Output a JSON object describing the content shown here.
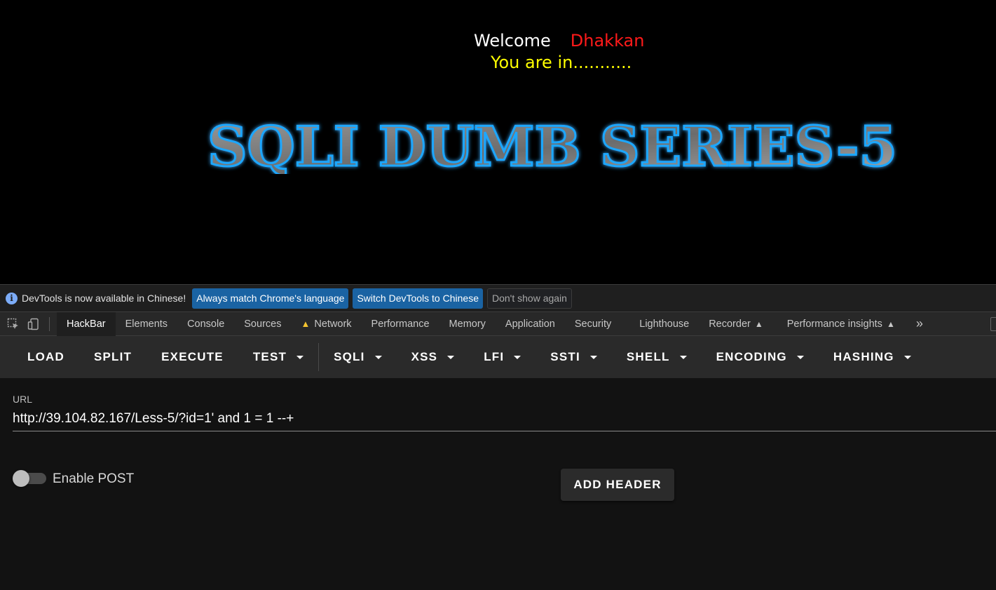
{
  "page": {
    "welcome_word": "Welcome",
    "username": "Dhakkan",
    "status": "You are in...........",
    "banner_text": "SQLI DUMB SERIES-5",
    "colors": {
      "welcome": "#ffffff",
      "username": "#ff1a1a",
      "status": "#ffff00",
      "banner_glow": "#1ea7ff"
    }
  },
  "infobar": {
    "message": "DevTools is now available in Chinese!",
    "btn_match": "Always match Chrome's language",
    "btn_switch": "Switch DevTools to Chinese",
    "btn_dismiss": "Don't show again"
  },
  "tabs": {
    "hackbar": "HackBar",
    "elements": "Elements",
    "console": "Console",
    "sources": "Sources",
    "network": "Network",
    "performance": "Performance",
    "memory": "Memory",
    "application": "Application",
    "security": "Security",
    "lighthouse": "Lighthouse",
    "recorder": "Recorder",
    "performance_insights": "Performance insights",
    "more": "»"
  },
  "hackbar": {
    "load": "LOAD",
    "split": "SPLIT",
    "execute": "EXECUTE",
    "test": "TEST",
    "sqli": "SQLI",
    "xss": "XSS",
    "lfi": "LFI",
    "ssti": "SSTI",
    "shell": "SHELL",
    "encoding": "ENCODING",
    "hashing": "HASHING",
    "url_label": "URL",
    "url_value": "http://39.104.82.167/Less-5/?id=1' and 1 = 1 --+",
    "enable_post_label": "Enable POST",
    "enable_post": false,
    "add_header": "ADD HEADER"
  }
}
